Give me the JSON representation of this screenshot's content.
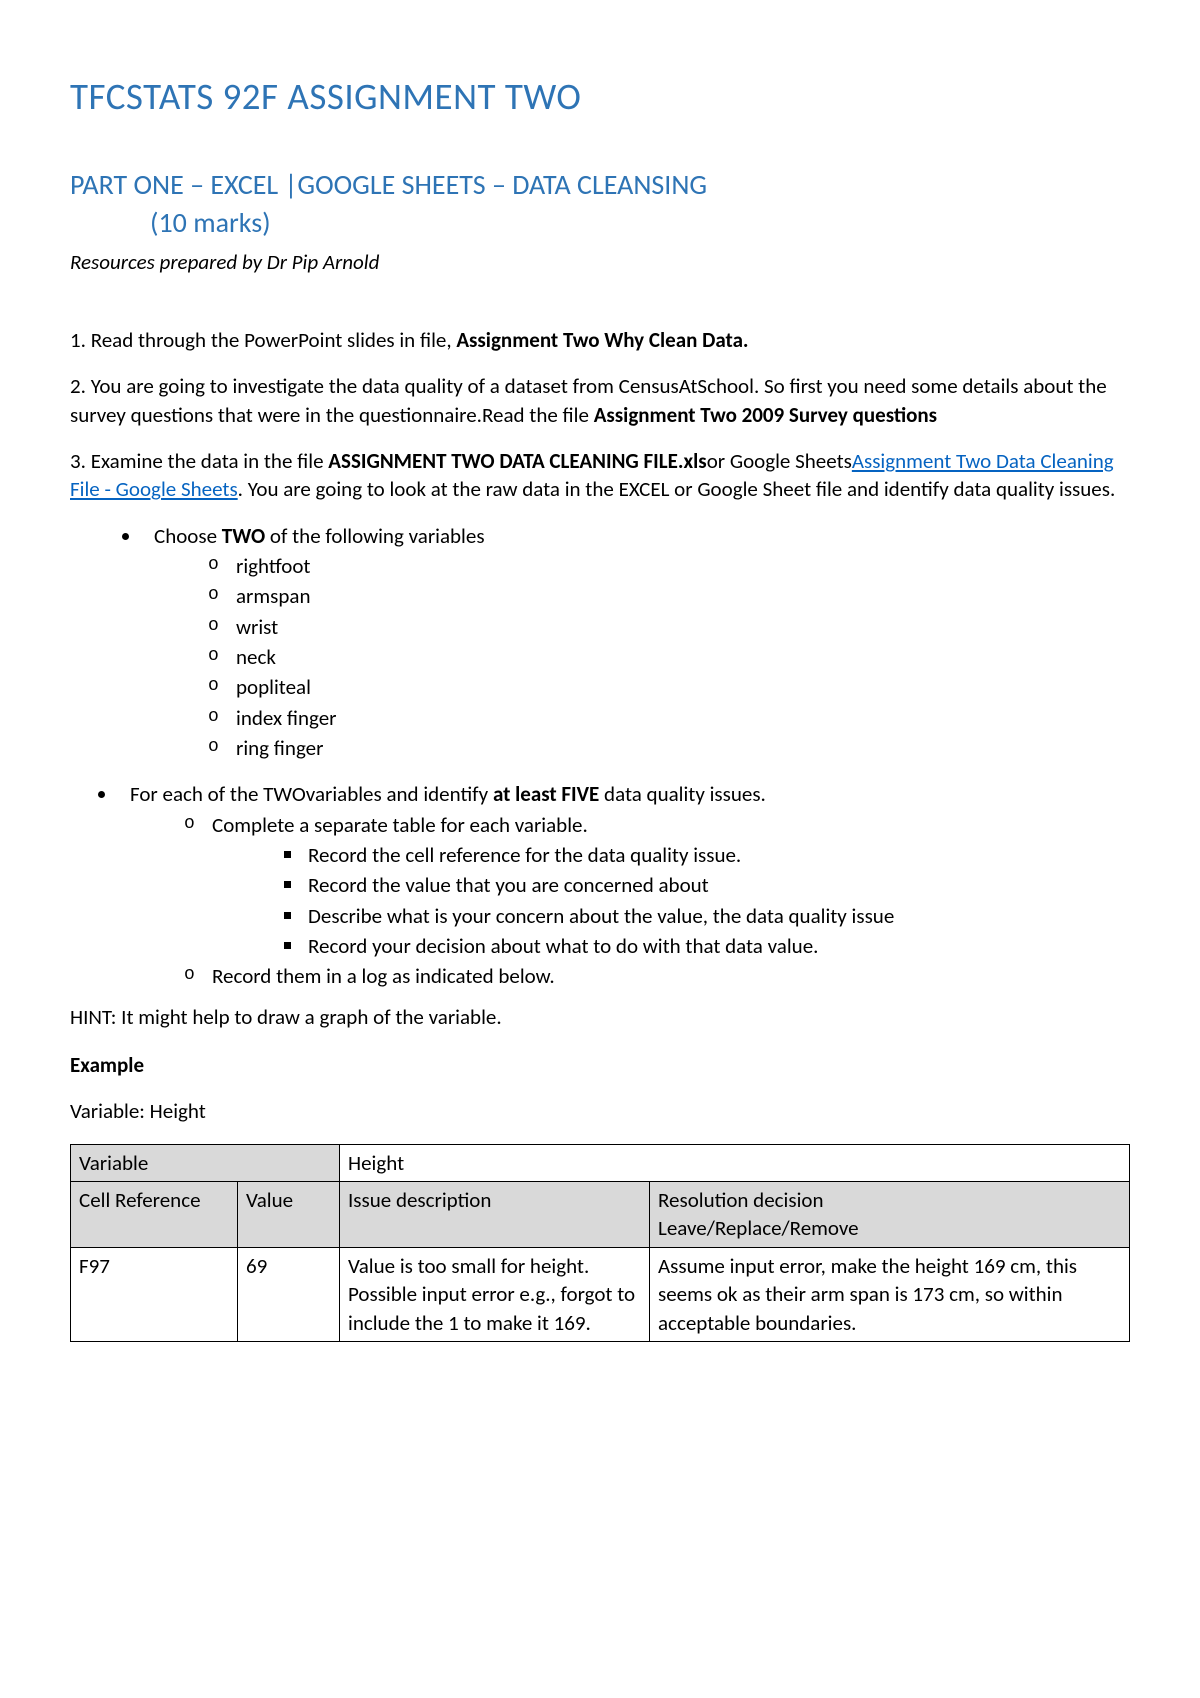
{
  "title": "TFCSTATS 92F ASSIGNMENT TWO",
  "subtitle_line1": "PART ONE – EXCEL |GOOGLE SHEETS – DATA CLEANSING",
  "subtitle_line2": "(10 marks)",
  "byline": "Resources prepared by Dr Pip Arnold",
  "p1_pre": "1. Read through the PowerPoint slides in file, ",
  "p1_bold": "Assignment Two Why Clean Data.",
  "p2_pre": "2. You are going to investigate the data quality of a dataset from CensusAtSchool. So first you need some details about the survey questions that were in the questionnaire.Read the file ",
  "p2_bold": "Assignment Two 2009 Survey questions",
  "p3_pre": "3. Examine the data in the file ",
  "p3_bold": "ASSIGNMENT TWO DATA CLEANING FILE.xls",
  "p3_mid": "or Google Sheets",
  "p3_link": "Assignment Two Data Cleaning File - Google Sheets",
  "p3_post": ". You are going to look at the raw data in the EXCEL or Google Sheet file and identify data quality issues.",
  "bullet1_pre": "Choose ",
  "bullet1_bold": "TWO",
  "bullet1_post": " of the following variables",
  "vars": {
    "v0": "rightfoot",
    "v1": "armspan",
    "v2": "wrist",
    "v3": "neck",
    "v4": "popliteal",
    "v5": "index finger",
    "v6": "ring finger"
  },
  "bullet2_pre": "For each of the TWOvariables and identify ",
  "bullet2_bold": "at least FIVE",
  "bullet2_post": " data quality issues.",
  "sub_a": "Complete a separate table for each variable.",
  "sq_a": "Record the cell reference for the data quality issue.",
  "sq_b": "Record the value that you are concerned about",
  "sq_c": "Describe what is your concern about the value, the data quality issue",
  "sq_d": "Record your decision about what to do with that data value.",
  "sub_b": "Record them in a log as indicated below.",
  "hint": "HINT: It might help to draw a graph of the variable.",
  "example_label": "Example",
  "example_var_line": "Variable: Height",
  "table": {
    "r1c1": "Variable",
    "r1c2": "Height",
    "r2c1": "Cell Reference",
    "r2c2": "Value",
    "r2c3": "Issue description",
    "r2c4a": "Resolution decision",
    "r2c4b": "Leave/Replace/Remove",
    "r3c1": "F97",
    "r3c2": "69",
    "r3c3": "Value is too small for height. Possible input error e.g., forgot to include the 1 to make it 169.",
    "r3c4": "Assume input error, make the height 169 cm, this seems ok as their arm span is 173 cm, so within acceptable boundaries."
  }
}
